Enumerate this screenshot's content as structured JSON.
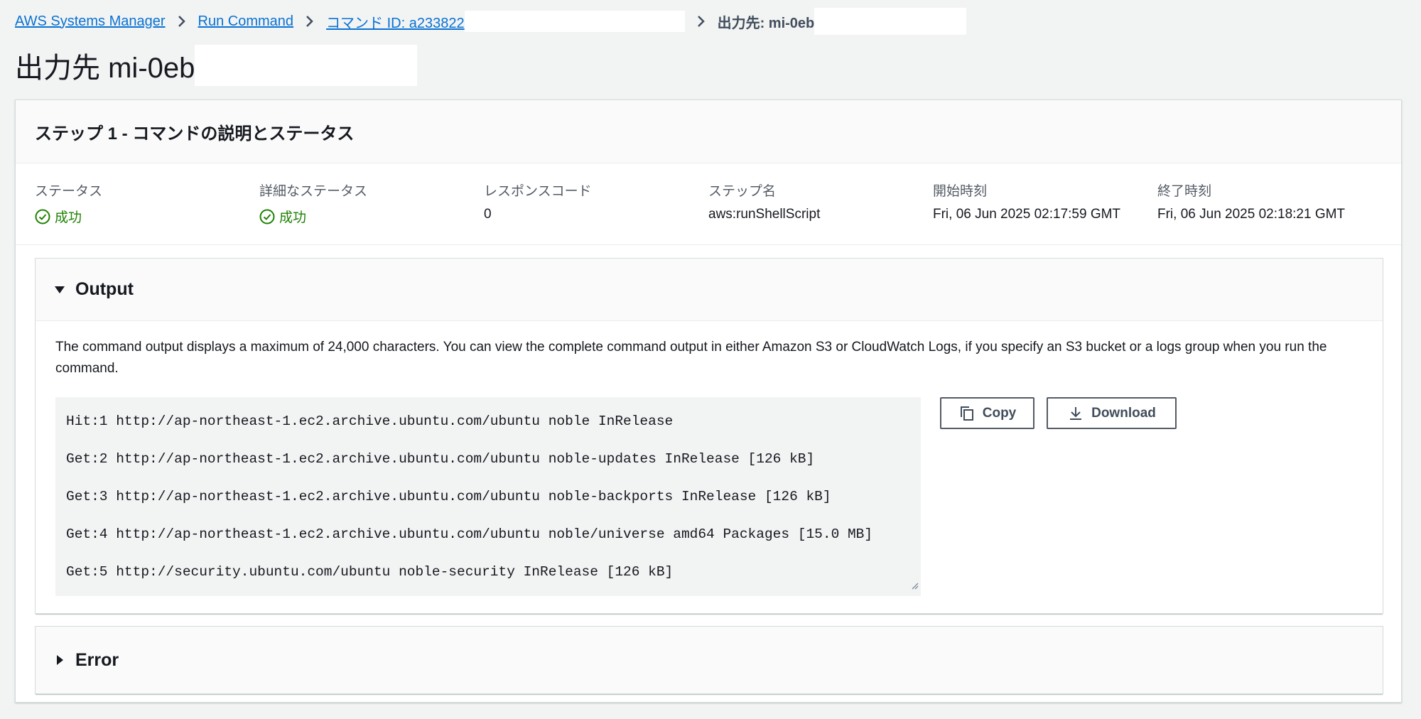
{
  "breadcrumb": {
    "items": [
      "AWS Systems Manager",
      "Run Command",
      "コマンド ID: a233822"
    ],
    "current": "出力先: mi-0eb"
  },
  "page": {
    "title": "出力先 mi-0eb"
  },
  "step": {
    "title": "ステップ 1 - コマンドの説明とステータス",
    "fields": [
      {
        "label": "ステータス",
        "value": "成功",
        "success": true
      },
      {
        "label": "詳細なステータス",
        "value": "成功",
        "success": true
      },
      {
        "label": "レスポンスコード",
        "value": "0"
      },
      {
        "label": "ステップ名",
        "value": "aws:runShellScript"
      },
      {
        "label": "開始時刻",
        "value": "Fri, 06 Jun 2025 02:17:59 GMT"
      },
      {
        "label": "終了時刻",
        "value": "Fri, 06 Jun 2025 02:18:21 GMT"
      }
    ]
  },
  "output": {
    "title": "Output",
    "description": "The command output displays a maximum of 24,000 characters. You can view the complete command output in either Amazon S3 or CloudWatch Logs, if you specify an S3 bucket or a logs group when you run the command.",
    "lines": [
      "Hit:1 http://ap-northeast-1.ec2.archive.ubuntu.com/ubuntu noble InRelease",
      "Get:2 http://ap-northeast-1.ec2.archive.ubuntu.com/ubuntu noble-updates InRelease [126 kB]",
      "Get:3 http://ap-northeast-1.ec2.archive.ubuntu.com/ubuntu noble-backports InRelease [126 kB]",
      "Get:4 http://ap-northeast-1.ec2.archive.ubuntu.com/ubuntu noble/universe amd64 Packages [15.0 MB]",
      "Get:5 http://security.ubuntu.com/ubuntu noble-security InRelease [126 kB]"
    ],
    "copy_label": "Copy",
    "download_label": "Download"
  },
  "error": {
    "title": "Error"
  },
  "colors": {
    "link": "#0972d3",
    "success": "#1d8102",
    "background": "#f2f3f3"
  },
  "icons": {
    "breadcrumb_separator": "chevron-right-icon",
    "status": "check-circle-icon",
    "output_expanded": "caret-down-icon",
    "error_collapsed": "caret-right-icon",
    "copy": "copy-icon",
    "download": "download-icon"
  }
}
